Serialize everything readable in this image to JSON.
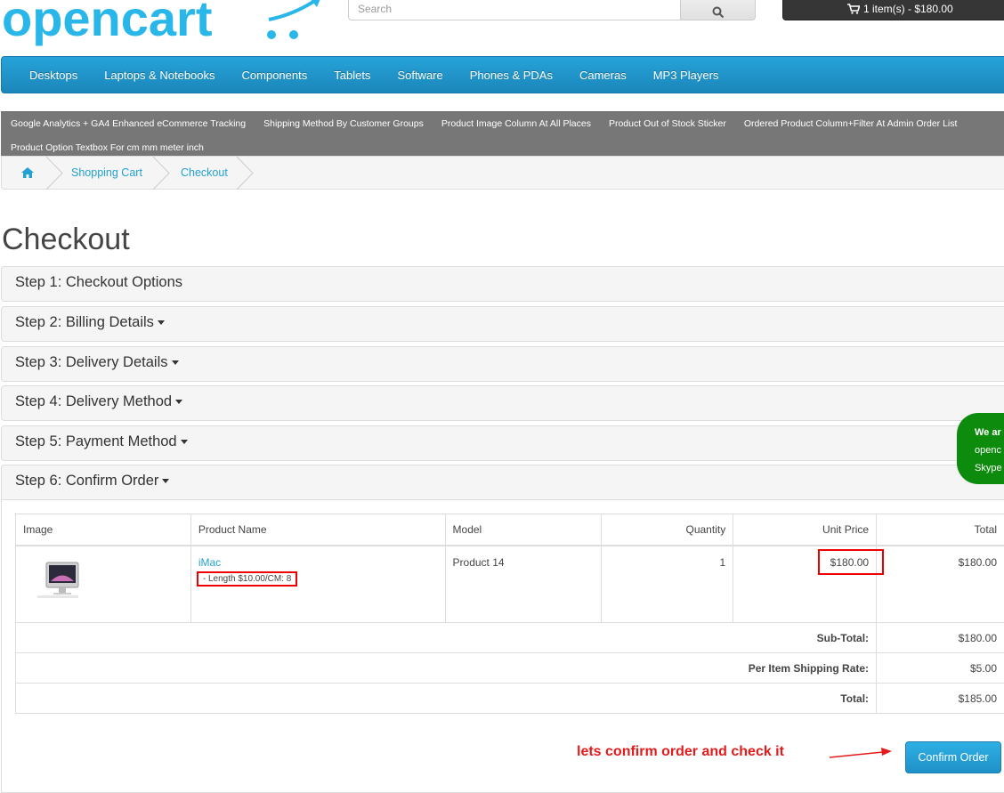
{
  "header": {
    "logo_text": "opencart",
    "search_placeholder": "Search",
    "cart_label": "1 item(s) - $180.00"
  },
  "nav": {
    "items": [
      "Desktops",
      "Laptops & Notebooks",
      "Components",
      "Tablets",
      "Software",
      "Phones & PDAs",
      "Cameras",
      "MP3 Players"
    ]
  },
  "ext_links": {
    "row1": [
      "Google Analytics + GA4 Enhanced eCommerce Tracking",
      "Shipping Method By Customer Groups",
      "Product Image Column At All Places",
      "Product Out of Stock Sticker",
      "Ordered Product Column+Filter At Admin Order List"
    ],
    "row2": [
      "Product Option Textbox For cm mm meter inch"
    ]
  },
  "breadcrumb": {
    "home_icon": "home-icon",
    "items": [
      "Shopping Cart",
      "Checkout"
    ]
  },
  "page_title": "Checkout",
  "steps": [
    {
      "label": "Step 1: Checkout Options"
    },
    {
      "label": "Step 2: Billing Details"
    },
    {
      "label": "Step 3: Delivery Details"
    },
    {
      "label": "Step 4: Delivery Method"
    },
    {
      "label": "Step 5: Payment Method"
    },
    {
      "label": "Step 6: Confirm Order"
    }
  ],
  "order_table": {
    "headers": [
      "Image",
      "Product Name",
      "Model",
      "Quantity",
      "Unit Price",
      "Total"
    ],
    "row": {
      "product_name": "iMac",
      "option": "- Length $10.00/CM: 8",
      "model": "Product 14",
      "quantity": "1",
      "unit_price": "$180.00",
      "total": "$180.00"
    },
    "totals": [
      {
        "label": "Sub-Total:",
        "value": "$180.00"
      },
      {
        "label": "Per Item Shipping Rate:",
        "value": "$5.00"
      },
      {
        "label": "Total:",
        "value": "$185.00"
      }
    ]
  },
  "annotation": "lets confirm order and check it",
  "confirm_button": "Confirm Order",
  "chat": {
    "line1": "We ar",
    "line2": "openc",
    "line3": "Skype"
  },
  "colors": {
    "accent": "#23a1d1",
    "nav_bg": "#229ac8",
    "annotation_red": "#e31b1b",
    "chat_green": "#0c8b0c"
  }
}
